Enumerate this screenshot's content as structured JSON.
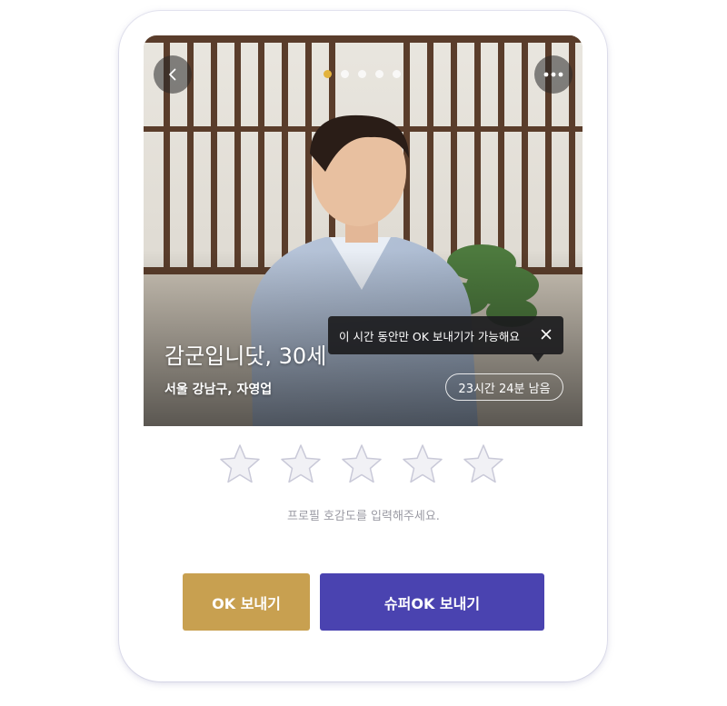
{
  "profile": {
    "name_age": "감군입니닷, 30세",
    "location_job": "서울 강남구, 자영업",
    "photo_count": 5,
    "active_photo_index": 0
  },
  "tooltip": {
    "text": "이 시간 동안만 OK 보내기가 가능해요"
  },
  "timer": {
    "text": "23시간 24분 남음"
  },
  "rating": {
    "max": 5,
    "value": 0,
    "hint": "프로필 호감도를 입력해주세요."
  },
  "actions": {
    "ok_label": "OK 보내기",
    "super_ok_label": "슈퍼OK 보내기"
  },
  "icons": {
    "back": "chevron-left-icon",
    "more": "more-horizontal-icon",
    "close": "close-icon",
    "star": "star-outline-icon"
  },
  "colors": {
    "ok_button": "#c8a050",
    "super_ok_button": "#4a43b0",
    "active_dot": "#e2b23c",
    "star_fill": "#f1f1f5",
    "star_stroke": "#c9c9d8"
  }
}
